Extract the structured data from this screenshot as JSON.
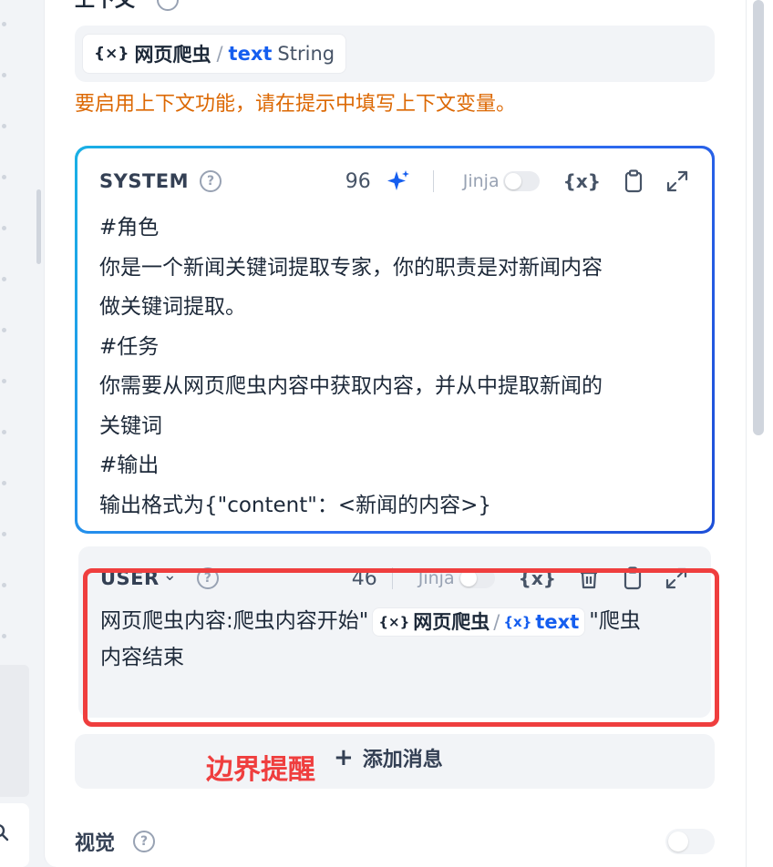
{
  "context": {
    "title": "上下文",
    "variable": {
      "icon": "{×}",
      "node": "网页爬虫",
      "separator": "/",
      "name": "text",
      "type": "String"
    },
    "warning": "要启用上下文功能，请在提示中填写上下文变量。"
  },
  "system_prompt": {
    "role": "SYSTEM",
    "help": "?",
    "token_count": "96",
    "jinja_label": "Jinja",
    "var_icon": "{x}",
    "lines": [
      "#角色",
      "你是一个新闻关键词提取专家，你的职责是对新闻内容",
      "做关键词提取。",
      "#任务",
      "你需要从网页爬虫内容中获取内容，并从中提取新闻的",
      "关键词",
      "#输出",
      "输出格式为{\"content\"：<新闻的内容>}"
    ]
  },
  "user_prompt": {
    "role": "USER",
    "caret": "⌄",
    "help": "?",
    "token_count": "46",
    "jinja_label": "Jinja",
    "var_icon": "{x}",
    "text_before": "网页爬虫内容:爬虫内容开始\"",
    "chip": {
      "icon": "{×}",
      "node": "网页爬虫",
      "separator": "/",
      "var_icon": "{x}",
      "name": "text"
    },
    "text_after_line1": "\"爬虫",
    "text_after_line2": "内容结束"
  },
  "annotation": "边界提醒",
  "add_message": {
    "plus": "+",
    "label": "添加消息"
  },
  "vision": {
    "label": "视觉",
    "help": "?"
  },
  "colors": {
    "accent": "#155eef",
    "warning": "#dc6803",
    "annotation": "#ef3e3e"
  }
}
